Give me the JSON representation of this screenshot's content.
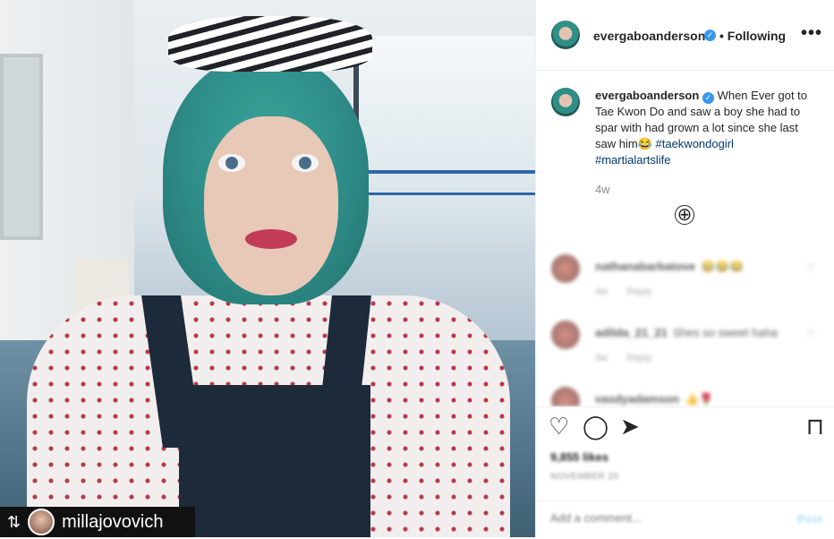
{
  "post": {
    "author": "evergaboanderson",
    "verified_mark": "✓",
    "follow_status": "• Following",
    "more_icon": "•••",
    "caption_body": "When Ever got to Tae Kwon Do and saw a boy she had to spar with had grown a lot since she last saw him😂",
    "hashtags": [
      "#taekwondogirl",
      "#martialartslife"
    ],
    "time_ago": "4w",
    "load_more_icon": "⊕"
  },
  "repost": {
    "icon": "⇅",
    "username": "millajovovich"
  },
  "comments": [
    {
      "user": "nathanabarbatove",
      "text": "😂😂😂",
      "age": "4w",
      "reply": "Reply"
    },
    {
      "user": "adilda_21_21",
      "text": "Shes so sweet haha",
      "age": "4w",
      "reply": "Reply"
    },
    {
      "user": "vasdyadamson",
      "text": "👍🌹",
      "age": "",
      "reply": ""
    }
  ],
  "actions": {
    "like_icon": "♡",
    "comment_icon": "◯",
    "share_icon": "➤",
    "save_icon": "⊓",
    "likes_count": "9,855 likes",
    "post_date": "NOVEMBER 20"
  },
  "add_comment": {
    "placeholder": "Add a comment...",
    "post_label": "Post"
  },
  "colors": {
    "link": "#00376b",
    "verified": "#3897f0",
    "muted": "#8e8e8e"
  }
}
